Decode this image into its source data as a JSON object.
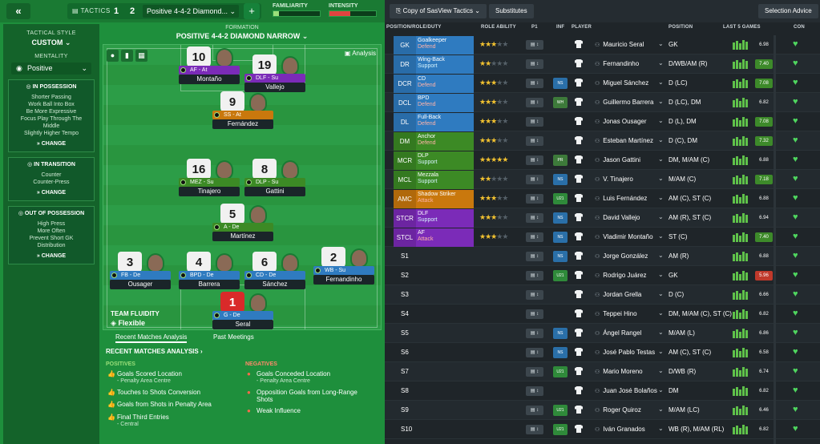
{
  "topbar": {
    "back_glyph": "«",
    "tactics_label": "TACTICS",
    "tactic_slots": [
      "1",
      "2"
    ],
    "tactic_name": "Positive 4-4-2 Diamond...",
    "add_glyph": "+",
    "familiarity_label": "FAMILIARITY",
    "intensity_label": "INTENSITY",
    "familiarity_level": 0.12,
    "intensity_level": 0.45
  },
  "sidebar": {
    "tactical_style_label": "TACTICAL STYLE",
    "tactical_style_value": "CUSTOM",
    "mentality_label": "MENTALITY",
    "mentality_value": "Positive",
    "sections": [
      {
        "title": "IN POSSESSION",
        "lines": [
          "Shorter Passing",
          "Work Ball Into Box",
          "Be More Expressive",
          "Focus Play Through The",
          "Middle",
          "Slightly Higher Tempo"
        ],
        "change": "CHANGE"
      },
      {
        "title": "IN TRANSITION",
        "lines": [
          "Counter",
          "Counter-Press"
        ],
        "change": "CHANGE"
      },
      {
        "title": "OUT OF POSSESSION",
        "lines": [
          "High Press",
          "More Often",
          "Prevent Short GK",
          "Distribution"
        ],
        "change": "CHANGE"
      }
    ]
  },
  "pitch": {
    "formation_label": "FORMATION",
    "formation_value": "POSITIVE 4-4-2 DIAMOND NARROW",
    "analysis_label": "Analysis",
    "players": [
      {
        "num": "10",
        "role": "AF - At",
        "name": "Montaño",
        "color": "#7b2bb8"
      },
      {
        "num": "19",
        "role": "DLF - Su",
        "name": "Vallejo",
        "color": "#7b2bb8"
      },
      {
        "num": "9",
        "role": "SS - At",
        "name": "Fernández",
        "color": "#c9780d"
      },
      {
        "num": "16",
        "role": "MEZ - Su",
        "name": "Tinajero",
        "color": "#3c8a25"
      },
      {
        "num": "8",
        "role": "DLP - Su",
        "name": "Gattini",
        "color": "#3c8a25"
      },
      {
        "num": "5",
        "role": "A - De",
        "name": "Martínez",
        "color": "#3c8a25"
      },
      {
        "num": "3",
        "role": "FB - De",
        "name": "Ousager",
        "color": "#2f7bc0"
      },
      {
        "num": "4",
        "role": "BPD - De",
        "name": "Barrera",
        "color": "#2f7bc0"
      },
      {
        "num": "6",
        "role": "CD - De",
        "name": "Sánchez",
        "color": "#2f7bc0"
      },
      {
        "num": "2",
        "role": "WB - Su",
        "name": "Fernandinho",
        "color": "#2f7bc0"
      },
      {
        "num": "1",
        "role": "G - De",
        "name": "Seral",
        "color": "#2f7bc0"
      }
    ],
    "fluidity_label": "TEAM FLUIDITY",
    "fluidity_value": "Flexible"
  },
  "analysis": {
    "tabs": [
      "Recent Matches Analysis",
      "Past Meetings"
    ],
    "header": "RECENT MATCHES ANALYSIS",
    "positives_label": "POSITIVES",
    "negatives_label": "NEGATIVES",
    "positives": [
      {
        "text": "Goals Scored Location",
        "sub": "- Penalty Area Centre"
      },
      {
        "text": "Touches to Shots Conversion",
        "sub": ""
      },
      {
        "text": "Goals from Shots in Penalty Area",
        "sub": ""
      },
      {
        "text": "Final Third Entries",
        "sub": "- Central"
      }
    ],
    "negatives": [
      {
        "text": "Goals Conceded Location",
        "sub": "- Penalty Area Centre"
      },
      {
        "text": "Opposition Goals from Long-Range Shots",
        "sub": ""
      },
      {
        "text": "Weak Influence",
        "sub": ""
      }
    ]
  },
  "right": {
    "copy_button": "Copy of SasView Tactics",
    "substitutes_button": "Substitutes",
    "selection_advice_button": "Selection Advice",
    "columns": {
      "position": "POSITION/ROLE/DUTY",
      "role_ability": "ROLE ABILITY",
      "p1": "P1",
      "inf": "INF",
      "player": "PLAYER",
      "pos": "POSITION",
      "last5": "LAST 5 GAMES",
      "con": "CON"
    },
    "rows": [
      {
        "code": "GK",
        "role": "Goalkeeper",
        "duty": "Defend",
        "color": "#2f7bc0",
        "stars": 3,
        "inf": "",
        "name": "Mauricio Seral",
        "pos": "GK",
        "rating": "6.98",
        "rcolor": ""
      },
      {
        "code": "DR",
        "role": "Wing-Back",
        "duty": "Support",
        "color": "#2f7bc0",
        "stars": 2,
        "inf": "",
        "name": "Fernandinho",
        "pos": "D/WB/AM (R)",
        "rating": "7.40",
        "rcolor": "#3d8a2a"
      },
      {
        "code": "DCR",
        "role": "CD",
        "duty": "Defend",
        "color": "#2f7bc0",
        "stars": 3,
        "inf": "NS",
        "name": "Miguel Sánchez",
        "pos": "D (LC)",
        "rating": "7.08",
        "rcolor": "#3d8a2a"
      },
      {
        "code": "DCL",
        "role": "BPD",
        "duty": "Defend",
        "color": "#2f7bc0",
        "stars": 3,
        "inf": "WH",
        "name": "Guillermo Barrera",
        "pos": "D (LC), DM",
        "rating": "6.82",
        "rcolor": ""
      },
      {
        "code": "DL",
        "role": "Full-Back",
        "duty": "Defend",
        "color": "#2f7bc0",
        "stars": 3,
        "inf": "",
        "name": "Jonas Ousager",
        "pos": "D (L), DM",
        "rating": "7.08",
        "rcolor": "#3d8a2a"
      },
      {
        "code": "DM",
        "role": "Anchor",
        "duty": "Defend",
        "color": "#3c8a25",
        "stars": 3,
        "inf": "",
        "name": "Esteban Martínez",
        "pos": "D (C), DM",
        "rating": "7.32",
        "rcolor": "#3d8a2a"
      },
      {
        "code": "MCR",
        "role": "DLP",
        "duty": "Support",
        "color": "#3c8a25",
        "stars": 5,
        "inf": "PR",
        "name": "Jason Gattini",
        "pos": "DM, M/AM (C)",
        "rating": "6.88",
        "rcolor": ""
      },
      {
        "code": "MCL",
        "role": "Mezzala",
        "duty": "Support",
        "color": "#3c8a25",
        "stars": 2,
        "inf": "NS",
        "name": "V. Tinajero",
        "pos": "M/AM (C)",
        "rating": "7.18",
        "rcolor": "#3d8a2a"
      },
      {
        "code": "AMC",
        "role": "Shadow Striker",
        "duty": "Attack",
        "color": "#c9780d",
        "stars": 3,
        "inf": "U21",
        "name": "Luis Fernández",
        "pos": "AM (C), ST (C)",
        "rating": "6.88",
        "rcolor": ""
      },
      {
        "code": "STCR",
        "role": "DLF",
        "duty": "Support",
        "color": "#7b2bb8",
        "stars": 3,
        "inf": "NS",
        "name": "David Vallejo",
        "pos": "AM (R), ST (C)",
        "rating": "6.94",
        "rcolor": ""
      },
      {
        "code": "STCL",
        "role": "AF",
        "duty": "Attack",
        "color": "#7b2bb8",
        "stars": 3,
        "inf": "NS",
        "name": "Vladimir Montaño",
        "pos": "ST (C)",
        "rating": "7.40",
        "rcolor": "#3d8a2a"
      }
    ],
    "subs": [
      {
        "code": "S1",
        "inf": "NS",
        "name": "Jorge González",
        "pos": "AM (R)",
        "rating": "6.88",
        "rcolor": ""
      },
      {
        "code": "S2",
        "inf": "U21",
        "name": "Rodrigo Juárez",
        "pos": "GK",
        "rating": "5.96",
        "rcolor": "#c0392b"
      },
      {
        "code": "S3",
        "inf": "",
        "name": "Jordan Grella",
        "pos": "D (C)",
        "rating": "6.66",
        "rcolor": ""
      },
      {
        "code": "S4",
        "inf": "",
        "name": "Teppei Hino",
        "pos": "DM, M/AM (C), ST (C)",
        "rating": "6.82",
        "rcolor": ""
      },
      {
        "code": "S5",
        "inf": "NS",
        "name": "Ángel Rangel",
        "pos": "M/AM (L)",
        "rating": "6.86",
        "rcolor": ""
      },
      {
        "code": "S6",
        "inf": "NS",
        "name": "José Pablo Testas",
        "pos": "AM (C), ST (C)",
        "rating": "6.58",
        "rcolor": ""
      },
      {
        "code": "S7",
        "inf": "U21",
        "name": "Mario Moreno",
        "pos": "D/WB (R)",
        "rating": "6.74",
        "rcolor": ""
      },
      {
        "code": "S8",
        "inf": "",
        "name": "Juan José Bolaños",
        "pos": "DM",
        "rating": "6.82",
        "rcolor": ""
      },
      {
        "code": "S9",
        "inf": "U21",
        "name": "Roger Quiroz",
        "pos": "M/AM (LC)",
        "rating": "6.46",
        "rcolor": ""
      },
      {
        "code": "S10",
        "inf": "U21",
        "name": "Iván Granados",
        "pos": "WB (R), M/AM (RL)",
        "rating": "6.82",
        "rcolor": ""
      }
    ]
  }
}
